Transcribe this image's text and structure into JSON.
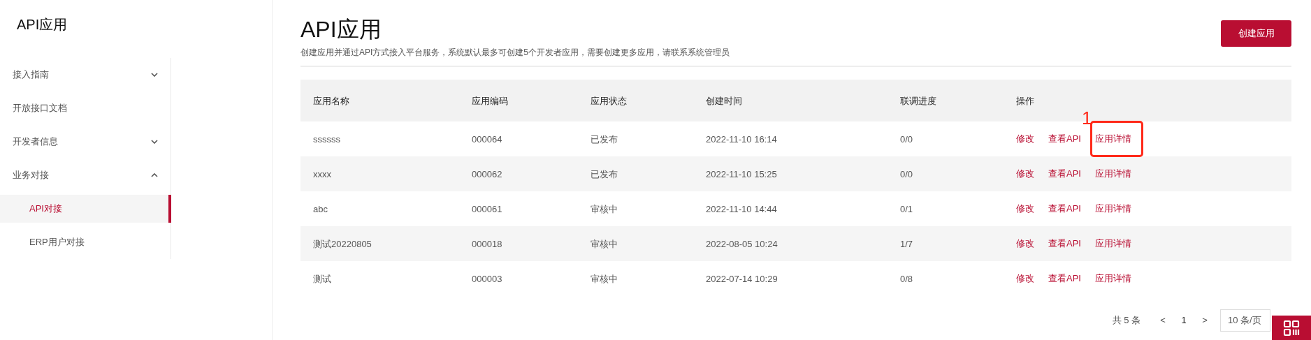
{
  "sidebar": {
    "title": "API应用",
    "items": [
      {
        "label": "接入指南",
        "expanded": false,
        "selected": false
      },
      {
        "label": "开放接口文档",
        "selected": false
      },
      {
        "label": "开发者信息",
        "expanded": false,
        "selected": false
      },
      {
        "label": "业务对接",
        "expanded": true,
        "selected": false,
        "children": [
          {
            "label": "API对接",
            "selected": true
          },
          {
            "label": "ERP用户对接",
            "selected": false
          }
        ]
      }
    ]
  },
  "header": {
    "title": "API应用",
    "description": "创建应用并通过API方式接入平台服务，系统默认最多可创建5个开发者应用，需要创建更多应用，请联系系统管理员",
    "create_button": "创建应用"
  },
  "table": {
    "columns": [
      "应用名称",
      "应用编码",
      "应用状态",
      "创建时间",
      "联调进度",
      "操作"
    ],
    "rows": [
      {
        "cells": [
          "ssssss",
          "000064",
          "已发布",
          "2022-11-10 16:14",
          "0/0"
        ],
        "actions": [
          {
            "label": "修改",
            "highlighted": false
          },
          {
            "label": "查看API",
            "highlighted": false
          },
          {
            "label": "应用详情",
            "highlighted": true
          }
        ]
      },
      {
        "cells": [
          "xxxx",
          "000062",
          "已发布",
          "2022-11-10 15:25",
          "0/0"
        ],
        "actions": [
          {
            "label": "修改",
            "highlighted": false
          },
          {
            "label": "查看API",
            "highlighted": false
          },
          {
            "label": "应用详情",
            "highlighted": false
          }
        ]
      },
      {
        "cells": [
          "abc",
          "000061",
          "审核中",
          "2022-11-10 14:44",
          "0/1"
        ],
        "actions": [
          {
            "label": "修改",
            "highlighted": false
          },
          {
            "label": "查看API",
            "highlighted": false
          },
          {
            "label": "应用详情",
            "highlighted": false
          }
        ]
      },
      {
        "cells": [
          "测试20220805",
          "000018",
          "审核中",
          "2022-08-05 10:24",
          "1/7"
        ],
        "actions": [
          {
            "label": "修改",
            "highlighted": false
          },
          {
            "label": "查看API",
            "highlighted": false
          },
          {
            "label": "应用详情",
            "highlighted": false
          }
        ]
      },
      {
        "cells": [
          "测试",
          "000003",
          "审核中",
          "2022-07-14 10:29",
          "0/8"
        ],
        "actions": [
          {
            "label": "修改",
            "highlighted": false
          },
          {
            "label": "查看API",
            "highlighted": false
          },
          {
            "label": "应用详情",
            "highlighted": false
          }
        ]
      }
    ]
  },
  "annotation": {
    "label": "1"
  },
  "pagination": {
    "total": "共 5 条",
    "prev": "<",
    "page": "1",
    "next": ">",
    "page_size": "10 条/页"
  }
}
